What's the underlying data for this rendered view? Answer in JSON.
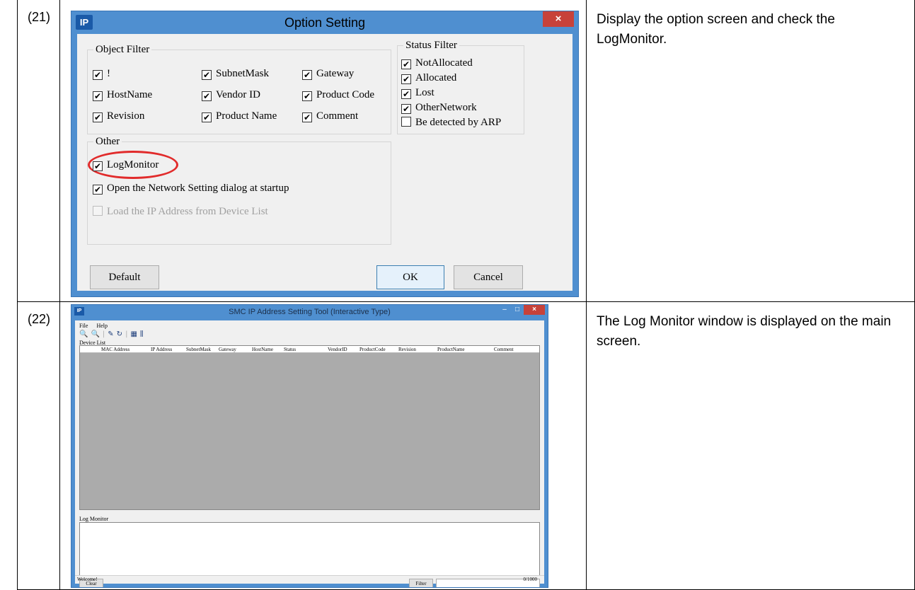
{
  "rows": [
    {
      "number": "(21)",
      "description": "Display the option screen and check the LogMonitor.",
      "dialog": {
        "logo": "IP",
        "title": "Option Setting",
        "close": "×",
        "object_filter": {
          "legend": "Object Filter",
          "items": [
            {
              "label": "!",
              "checked": true
            },
            {
              "label": "SubnetMask",
              "checked": true
            },
            {
              "label": "Gateway",
              "checked": true
            },
            {
              "label": "HostName",
              "checked": true
            },
            {
              "label": "Vendor ID",
              "checked": true
            },
            {
              "label": "Product Code",
              "checked": true
            },
            {
              "label": "Revision",
              "checked": true
            },
            {
              "label": "Product Name",
              "checked": true
            },
            {
              "label": "Comment",
              "checked": true
            }
          ]
        },
        "status_filter": {
          "legend": "Status Filter",
          "items": [
            {
              "label": "NotAllocated",
              "checked": true
            },
            {
              "label": "Allocated",
              "checked": true
            },
            {
              "label": "Lost",
              "checked": true
            },
            {
              "label": "OtherNetwork",
              "checked": true
            },
            {
              "label": "Be detected by ARP",
              "checked": false
            }
          ]
        },
        "other": {
          "legend": "Other",
          "items": [
            {
              "label": "LogMonitor",
              "checked": true,
              "highlighted": true
            },
            {
              "label": "Open the Network Setting dialog at startup",
              "checked": true
            },
            {
              "label": "Load the IP Address from Device List",
              "checked": false,
              "disabled": true
            }
          ]
        },
        "buttons": {
          "default": "Default",
          "ok": "OK",
          "cancel": "Cancel"
        },
        "check_glyph": "✔"
      }
    },
    {
      "number": "(22)",
      "description": "The Log Monitor window is displayed on the main screen.",
      "main_window": {
        "logo": "IP",
        "title": "SMC IP Address Setting Tool (Interactive Type)",
        "controls": {
          "minimize": "–",
          "maximize": "□",
          "close": "×"
        },
        "menu": [
          "File",
          "Help"
        ],
        "toolbar_icons": [
          {
            "name": "search-icon",
            "glyph": "🔍"
          },
          {
            "name": "zoom-icon",
            "glyph": "🔍"
          },
          {
            "name": "separator",
            "glyph": "|"
          },
          {
            "name": "edit-icon",
            "glyph": "✎"
          },
          {
            "name": "refresh-icon",
            "glyph": "↻"
          },
          {
            "name": "separator",
            "glyph": "|"
          },
          {
            "name": "network-icon",
            "glyph": "▦"
          },
          {
            "name": "settings-icon",
            "glyph": "⫼"
          }
        ],
        "device_list_label": "Device List",
        "columns": [
          "MAC Address",
          "IP Address",
          "SubnetMask",
          "Gateway",
          "HostName",
          "Status",
          "VendorID",
          "ProductCode",
          "Revision",
          "ProductName",
          "Comment"
        ],
        "log_monitor_label": "Log Monitor",
        "clear_button": "Clear",
        "filter_button": "Filter",
        "status_text": "Welcome!",
        "log_count": "0/1000"
      }
    }
  ]
}
